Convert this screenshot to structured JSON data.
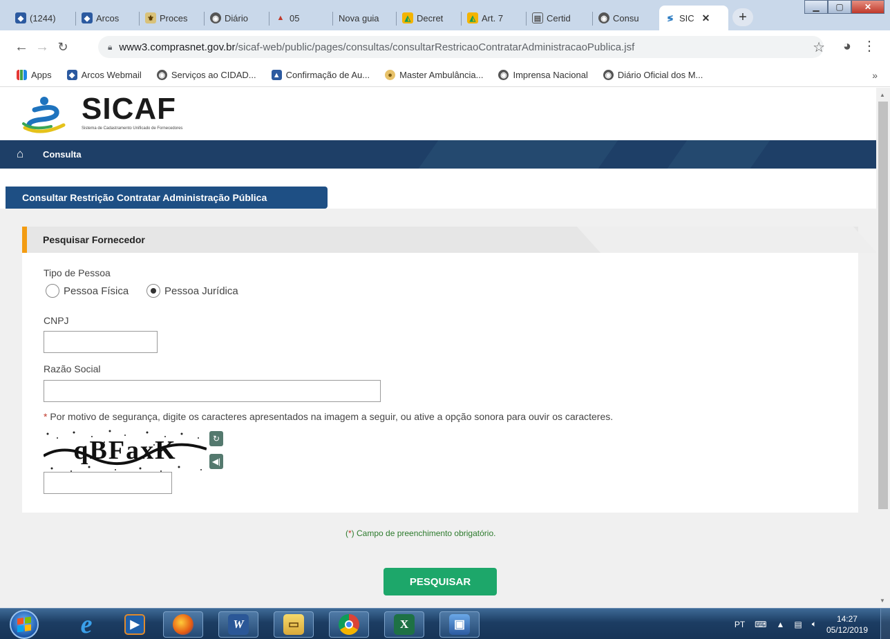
{
  "browser": {
    "tabs": [
      {
        "label": "(1244)",
        "icon": "webmail-icon"
      },
      {
        "label": "Arcos",
        "icon": "webmail-icon"
      },
      {
        "label": "Proces",
        "icon": "coat-of-arms-icon"
      },
      {
        "label": "Diário",
        "icon": "globe-icon"
      },
      {
        "label": "05",
        "icon": "drive-icon"
      },
      {
        "label": "Nova guia",
        "icon": "none"
      },
      {
        "label": "Decret",
        "icon": "google-drive-icon"
      },
      {
        "label": "Art. 7",
        "icon": "google-drive-icon"
      },
      {
        "label": "Certid",
        "icon": "document-icon"
      },
      {
        "label": "Consu",
        "icon": "globe-icon"
      },
      {
        "label": "SIC",
        "icon": "sicaf-icon",
        "active": true
      }
    ],
    "url_host": "www3.comprasnet.gov.br",
    "url_path": "/sicaf-web/public/pages/consultas/consultarRestricaoContratarAdministracaoPublica.jsf",
    "bookmarks": [
      {
        "label": "Apps",
        "icon": "apps-grid-icon"
      },
      {
        "label": "Arcos Webmail",
        "icon": "webmail-icon"
      },
      {
        "label": "Serviços ao CIDAD...",
        "icon": "globe-icon"
      },
      {
        "label": "Confirmação de Au...",
        "icon": "cap-icon"
      },
      {
        "label": "Master Ambulância...",
        "icon": "ambulance-icon"
      },
      {
        "label": "Imprensa Nacional",
        "icon": "globe-icon"
      },
      {
        "label": "Diário Oficial dos M...",
        "icon": "globe-icon"
      }
    ],
    "bookmarks_more": "»"
  },
  "site": {
    "logo_text": "SICAF",
    "logo_sub": "Sistema de Cadastramento Unificado de Fornecedores",
    "nav_item": "Consulta",
    "page_title": "Consultar Restrição Contratar Administração Pública"
  },
  "form": {
    "panel_title": "Pesquisar Fornecedor",
    "tipo_label": "Tipo de Pessoa",
    "option_fisica": "Pessoa Física",
    "option_juridica": "Pessoa Jurídica",
    "selected": "Pessoa Jurídica",
    "cnpj_label": "CNPJ",
    "cnpj_value": "",
    "razao_label": "Razão Social",
    "razao_value": "",
    "notice_star": "*",
    "notice": " Por motivo de segurança, digite os caracteres apresentados na imagem a seguir, ou ative a opção sonora para ouvir os caracteres.",
    "captcha_text": "qBFaxK",
    "captcha_value": "",
    "mandatory_open": "(",
    "mandatory_star": "*",
    "mandatory_text": ") Campo de preenchimento obrigatório.",
    "search_label": "PESQUISAR"
  },
  "taskbar": {
    "apps": [
      "windows-media-icon",
      "firefox-icon",
      "word-icon",
      "explorer-icon",
      "chrome-icon",
      "excel-icon",
      "network-icon"
    ],
    "language": "PT",
    "time": "14:27",
    "date": "05/12/2019"
  },
  "colors": {
    "nav_bg": "#1e3f67",
    "title_bg": "#1e4f84",
    "accent": "#f39c12",
    "search_button": "#1da76a",
    "mandatory_text": "#2c7a2c"
  }
}
